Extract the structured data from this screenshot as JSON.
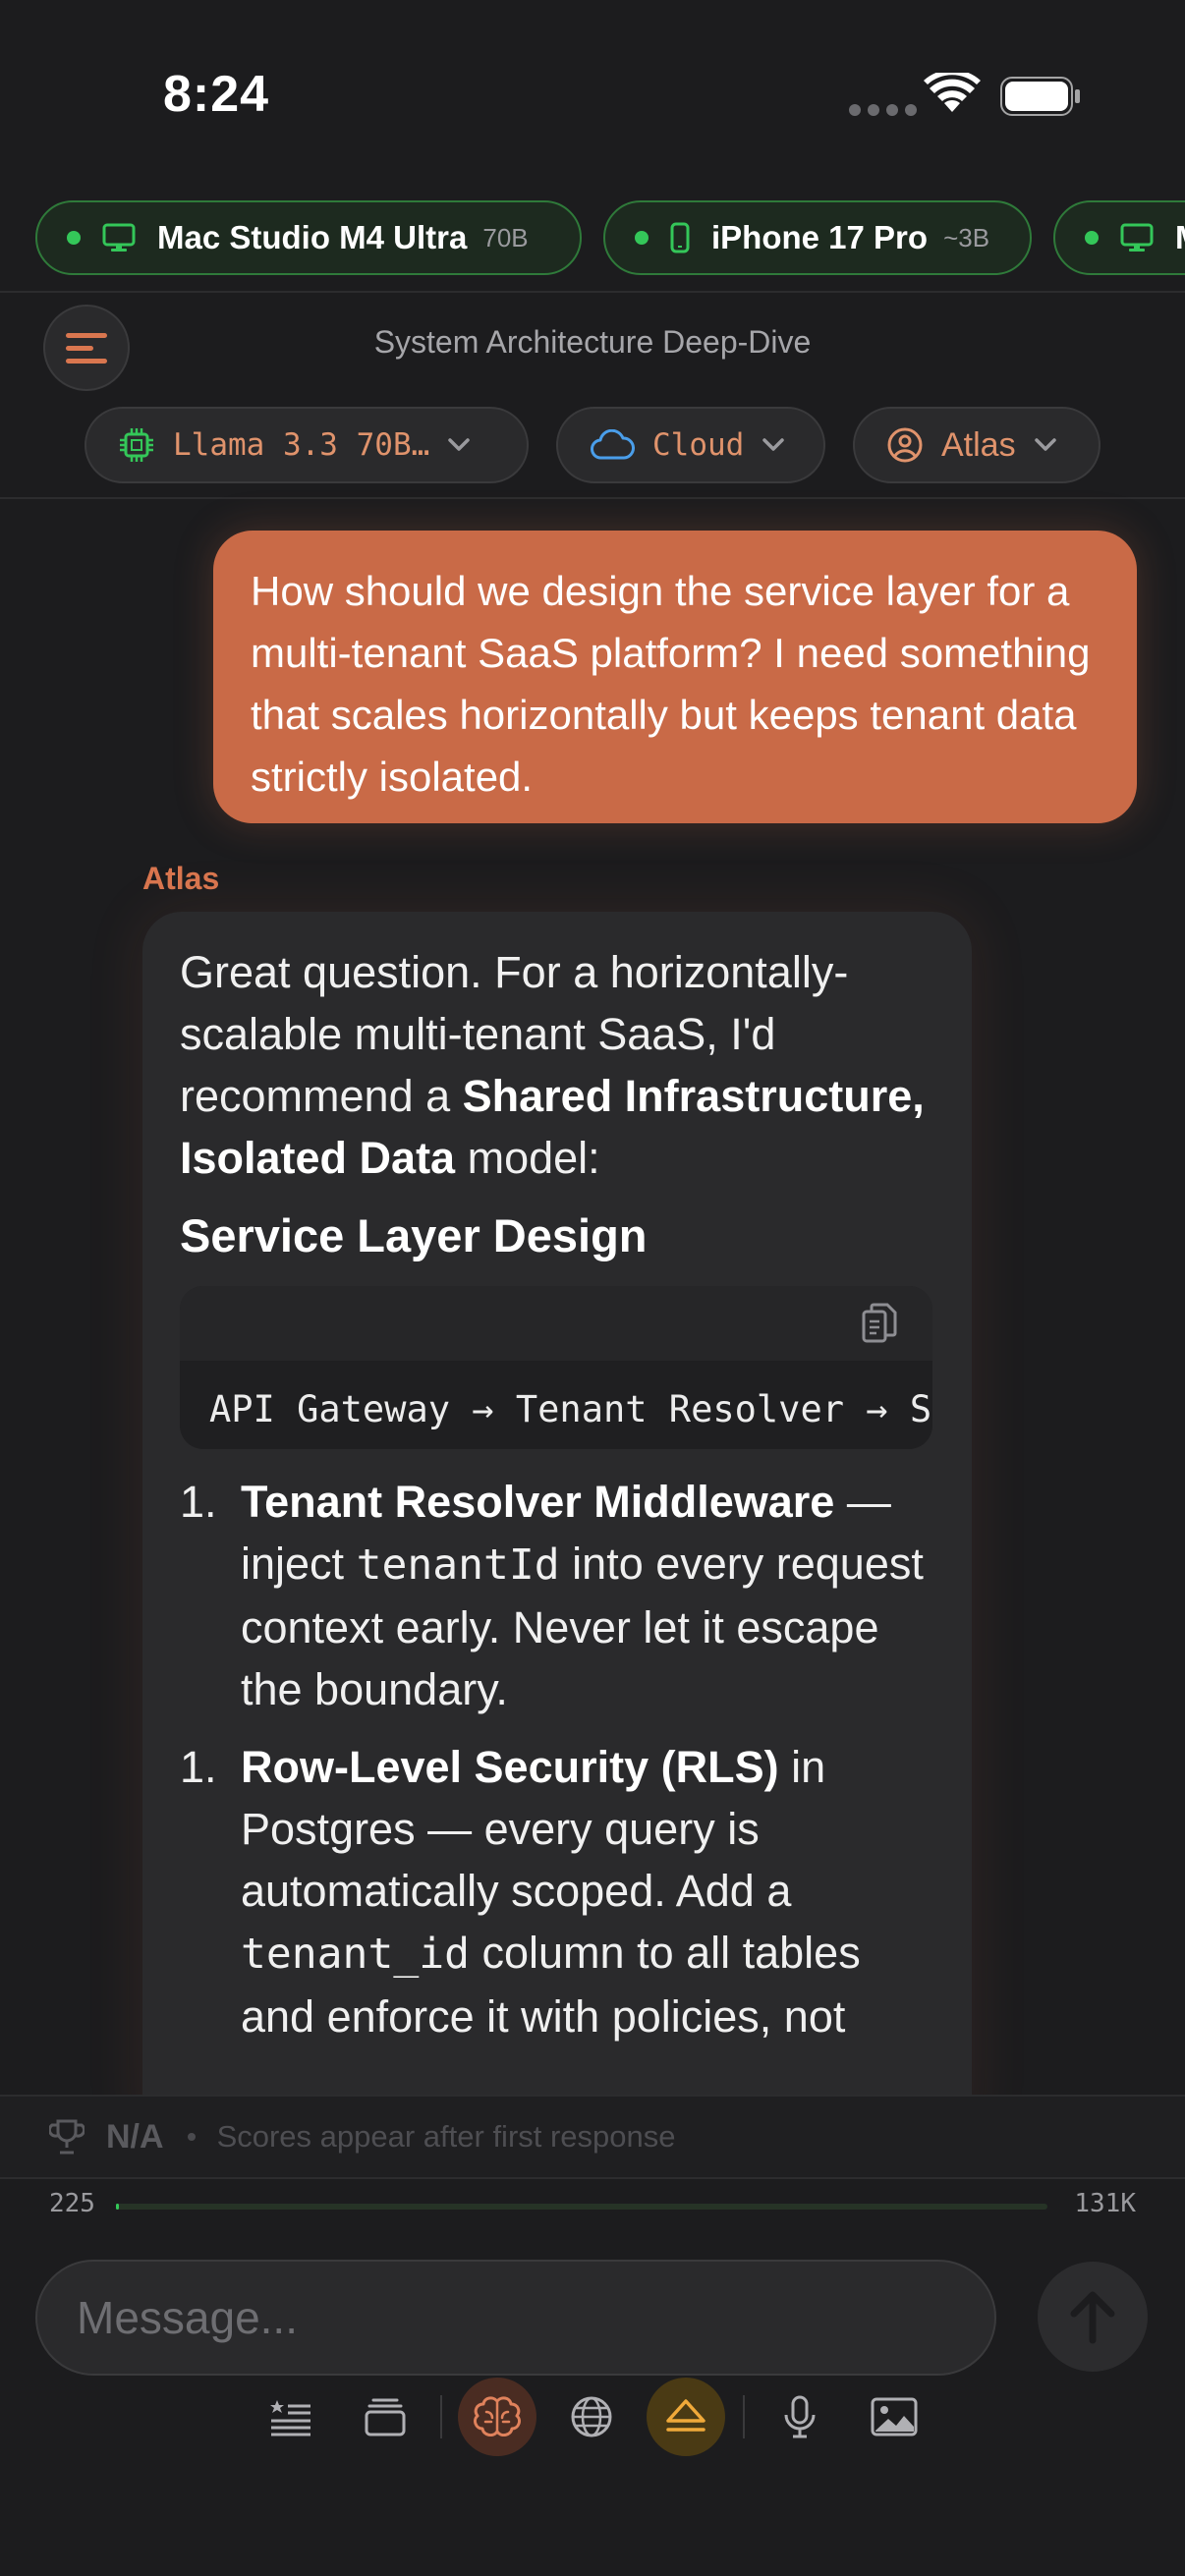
{
  "status_bar": {
    "time": "8:24"
  },
  "devices": [
    {
      "name": "Mac Studio M4 Ultra",
      "size": "70B",
      "icon": "desktop-icon"
    },
    {
      "name": "iPhone 17 Pro",
      "size": "~3B",
      "icon": "phone-icon"
    },
    {
      "name": "M",
      "size": "",
      "icon": "desktop-icon"
    }
  ],
  "header": {
    "title": "System Architecture Deep-Dive",
    "model_label": "Llama 3.3 70B…",
    "mode_label": "Cloud",
    "persona_label": "Atlas"
  },
  "chat": {
    "user_message": "How should we design the service layer for a multi-tenant SaaS platform? I need something that scales horizontally but keeps tenant data strictly isolated.",
    "assistant_name": "Atlas",
    "intro_1": "Great question. For a horizontally-scalable multi-tenant SaaS, I'd recommend a ",
    "intro_bold": "Shared Infrastructure, Isolated Data",
    "intro_2": " model:",
    "section_heading": "Service Layer Design",
    "code": "API Gateway → Tenant Resolver → Service Mesh",
    "list": [
      {
        "marker": "1.",
        "bold": "Tenant Resolver Middleware",
        "pre": " — inject ",
        "code": "tenantId",
        "post": " into every request context early. Never let it escape the boundary."
      },
      {
        "marker": "1.",
        "bold": "Row-Level Security (RLS)",
        "pre": " in Postgres — every query is automatically scoped. Add a ",
        "code": "tenant_id",
        "post": " column to all tables and enforce it with policies, not"
      }
    ]
  },
  "score": {
    "value": "N/A",
    "note": "Scores appear after first response"
  },
  "context": {
    "used": "225",
    "limit": "131K",
    "fraction": 0.0017
  },
  "composer": {
    "placeholder": "Message..."
  },
  "colors": {
    "accent": "#c96a47",
    "accent_text": "#e0936c",
    "green": "#34c759",
    "background": "#1c1c1e",
    "bubble": "#2a2a2c"
  }
}
